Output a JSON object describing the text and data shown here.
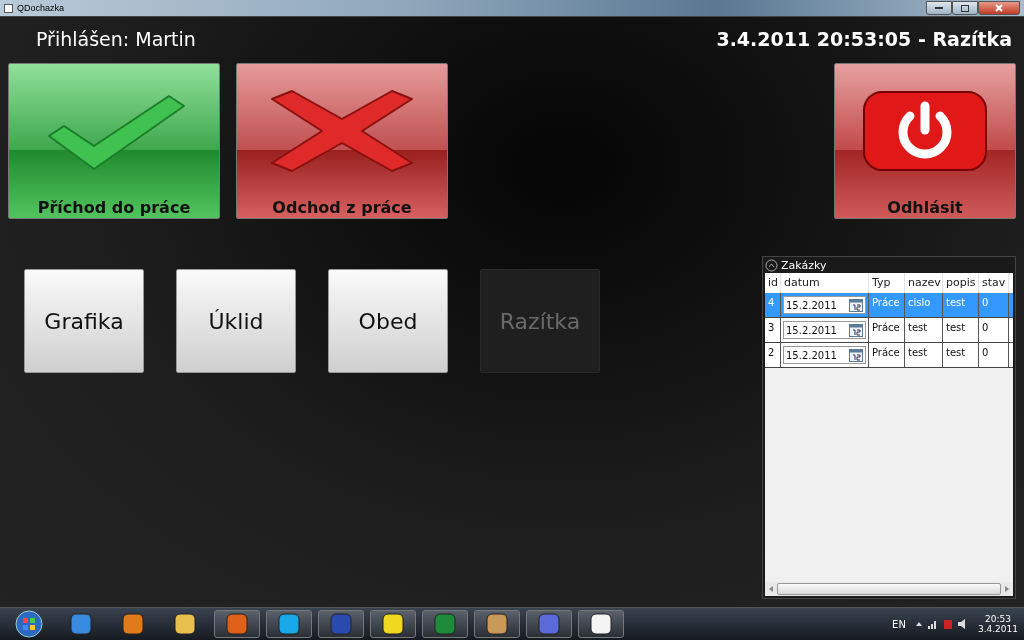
{
  "window": {
    "title": "QDochazka"
  },
  "header": {
    "user": "Přihlášen: Martin",
    "status": "3.4.2011 20:53:05 - Razítka"
  },
  "action_buttons": [
    {
      "kind": "arrive",
      "label": "Příchod do práce"
    },
    {
      "kind": "leave",
      "label": "Odchod z práce"
    },
    {
      "kind": "logout",
      "label": "Odhlásit"
    }
  ],
  "category_buttons": [
    {
      "label": "Grafika",
      "disabled": false
    },
    {
      "label": "Úklid",
      "disabled": false
    },
    {
      "label": "Obed",
      "disabled": false
    },
    {
      "label": "Razítka",
      "disabled": true
    }
  ],
  "orders": {
    "title": "Zakázky",
    "columns": [
      "id",
      "datum",
      "Typ",
      "nazev",
      "popis",
      "stav"
    ],
    "rows": [
      {
        "id": "4",
        "datum": "15.2.2011",
        "typ": "Práce",
        "nazev": "cislo",
        "popis": "test",
        "stav": "0",
        "selected": true
      },
      {
        "id": "3",
        "datum": "15.2.2011",
        "typ": "Práce",
        "nazev": "test",
        "popis": "test",
        "stav": "0",
        "selected": false
      },
      {
        "id": "2",
        "datum": "15.2.2011",
        "typ": "Práce",
        "nazev": "test",
        "popis": "test",
        "stav": "0",
        "selected": false
      }
    ]
  },
  "taskbar": {
    "language": "EN",
    "time": "20:53",
    "date": "3.4.2011"
  }
}
